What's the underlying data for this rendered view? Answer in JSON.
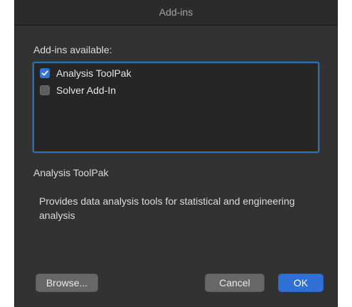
{
  "window": {
    "title": "Add-ins"
  },
  "addins": {
    "section_label": "Add-ins available:",
    "items": [
      {
        "label": "Analysis ToolPak",
        "checked": true
      },
      {
        "label": "Solver Add-In",
        "checked": false
      }
    ]
  },
  "description": {
    "title": "Analysis ToolPak",
    "text": "Provides data analysis tools for statistical and engineering analysis"
  },
  "buttons": {
    "browse_label": "Browse...",
    "cancel_label": "Cancel",
    "ok_label": "OK"
  },
  "colors": {
    "dialog_bg": "#323232",
    "focus_ring": "#2e6ea9",
    "primary_button": "#2f6fd6"
  }
}
